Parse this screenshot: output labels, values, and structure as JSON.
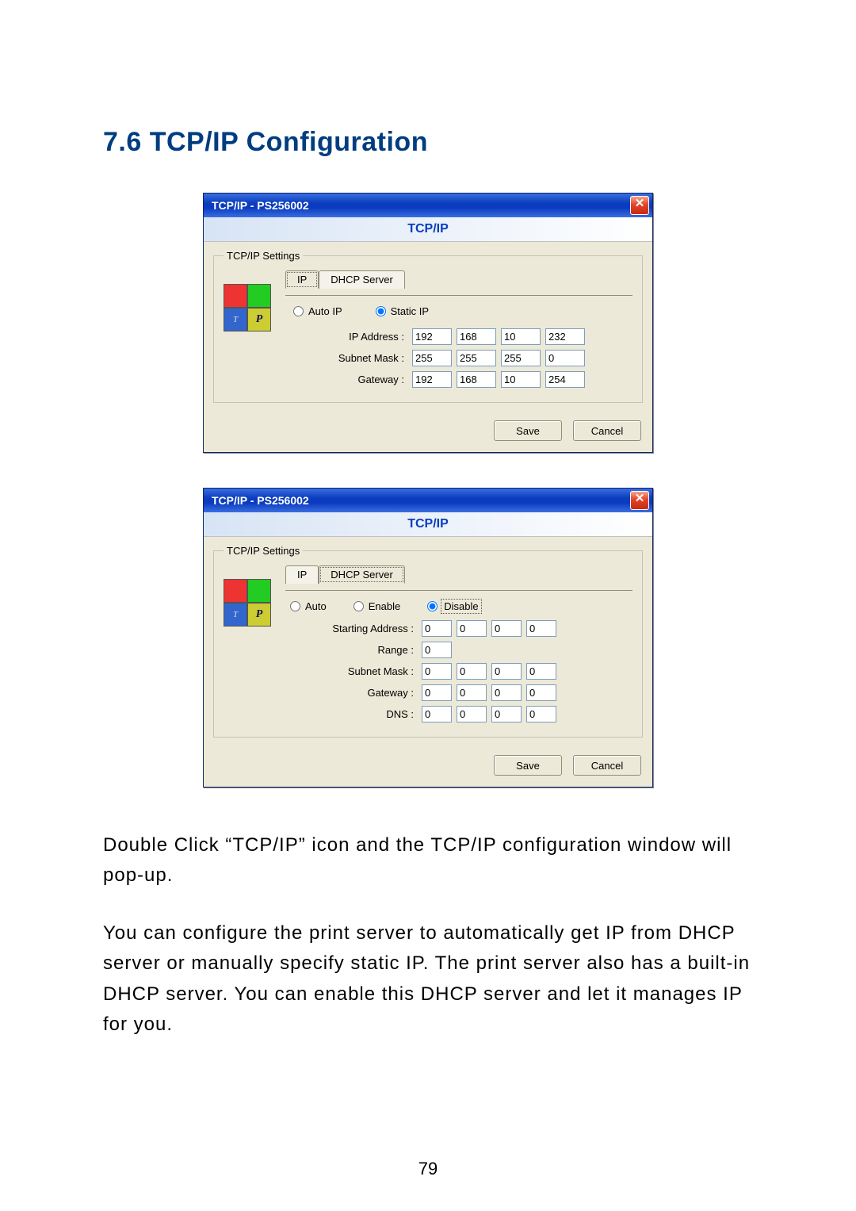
{
  "heading": "7.6  TCP/IP Configuration",
  "page_number": "79",
  "paragraphs": [
    "Double Click “TCP/IP” icon and the TCP/IP configuration window will pop-up.",
    "You can configure the print server to automatically get IP from DHCP server or manually specify static IP. The print server also has a built-in DHCP server. You can enable this DHCP server and let it manages IP for you."
  ],
  "dialog1": {
    "title": "TCP/IP - PS256002",
    "header": "TCP/IP",
    "groupbox": "TCP/IP Settings",
    "tabs": {
      "ip": "IP",
      "dhcp": "DHCP Server"
    },
    "radios": {
      "auto": "Auto IP",
      "static": "Static IP",
      "selected": "static"
    },
    "fields": {
      "ip_label": "IP Address :",
      "ip": [
        "192",
        "168",
        "10",
        "232"
      ],
      "mask_label": "Subnet Mask :",
      "mask": [
        "255",
        "255",
        "255",
        "0"
      ],
      "gw_label": "Gateway :",
      "gw": [
        "192",
        "168",
        "10",
        "254"
      ]
    },
    "buttons": {
      "save": "Save",
      "cancel": "Cancel"
    }
  },
  "dialog2": {
    "title": "TCP/IP - PS256002",
    "header": "TCP/IP",
    "groupbox": "TCP/IP Settings",
    "tabs": {
      "ip": "IP",
      "dhcp": "DHCP Server"
    },
    "radios": {
      "auto": "Auto",
      "enable": "Enable",
      "disable": "Disable",
      "selected": "disable"
    },
    "fields": {
      "start_label": "Starting Address :",
      "start": [
        "0",
        "0",
        "0",
        "0"
      ],
      "range_label": "Range :",
      "range": [
        "0"
      ],
      "mask_label": "Subnet Mask :",
      "mask": [
        "0",
        "0",
        "0",
        "0"
      ],
      "gw_label": "Gateway :",
      "gw": [
        "0",
        "0",
        "0",
        "0"
      ],
      "dns_label": "DNS :",
      "dns": [
        "0",
        "0",
        "0",
        "0"
      ]
    },
    "buttons": {
      "save": "Save",
      "cancel": "Cancel"
    }
  }
}
